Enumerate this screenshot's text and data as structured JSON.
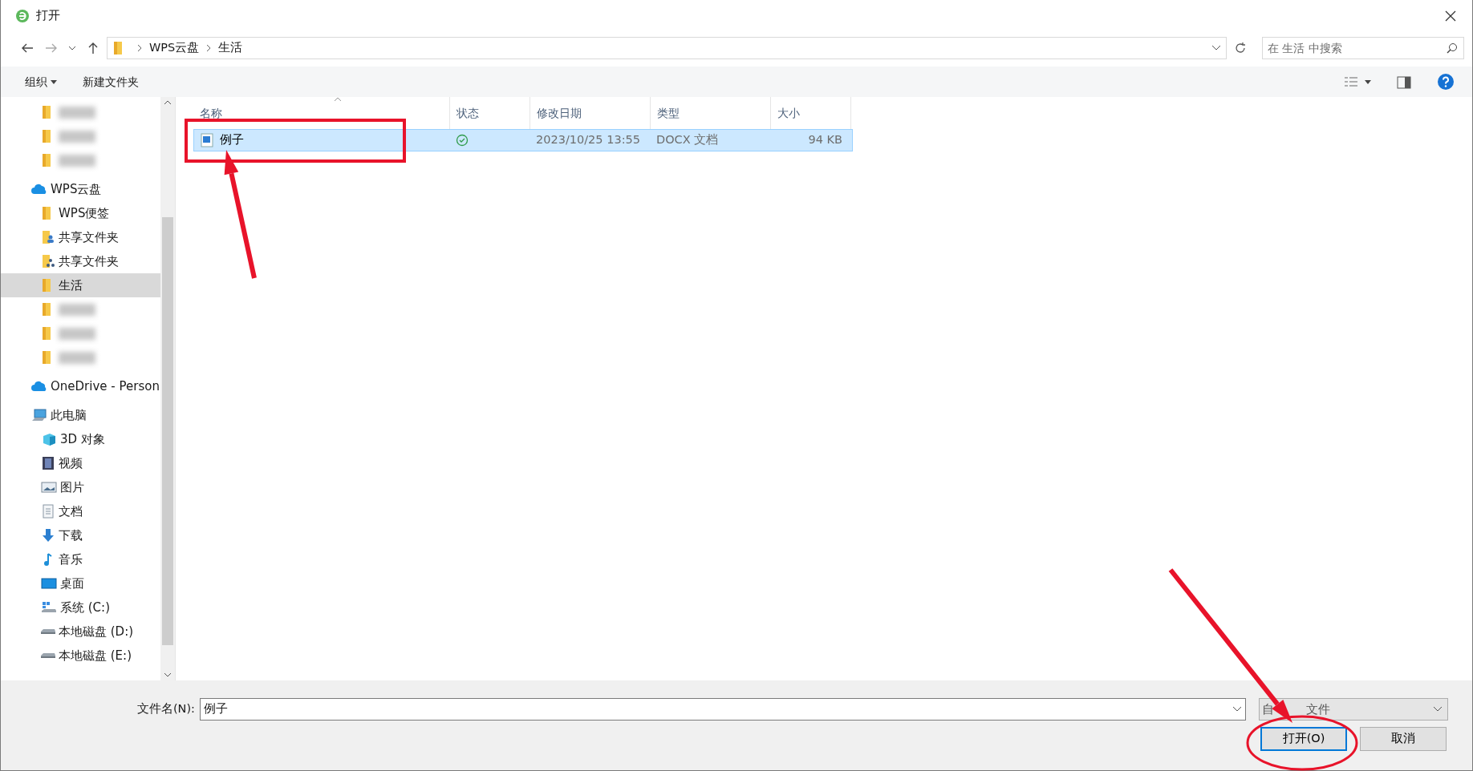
{
  "window": {
    "title": "打开"
  },
  "address": {
    "path": [
      "WPS云盘",
      "生活"
    ]
  },
  "search": {
    "placeholder": "在 生活 中搜索"
  },
  "toolbar": {
    "organize": "组织",
    "new_folder": "新建文件夹"
  },
  "sidebar": {
    "items": [
      {
        "kind": "folder",
        "blurred": true,
        "selected": false
      },
      {
        "kind": "folder",
        "blurred": true,
        "selected": false
      },
      {
        "kind": "folder",
        "blurred": true,
        "selected": false
      },
      {
        "kind": "cloud",
        "label": "WPS云盘",
        "selected": false,
        "children": [
          {
            "kind": "folder",
            "label": "WPS便签",
            "selected": false
          },
          {
            "kind": "shared",
            "label": "共享文件夹",
            "selected": false
          },
          {
            "kind": "shared2",
            "label": "共享文件夹",
            "selected": false
          },
          {
            "kind": "folder",
            "label": "生活",
            "selected": true
          },
          {
            "kind": "folder",
            "blurred": true,
            "selected": false
          },
          {
            "kind": "folder",
            "blurred": true,
            "selected": false
          },
          {
            "kind": "folder",
            "blurred": true,
            "selected": false
          }
        ]
      },
      {
        "kind": "cloud",
        "label": "OneDrive - Person",
        "selected": false
      },
      {
        "kind": "pc",
        "label": "此电脑",
        "selected": false,
        "children": [
          {
            "kind": "cube",
            "label": "3D 对象",
            "selected": false
          },
          {
            "kind": "video",
            "label": "视频",
            "selected": false
          },
          {
            "kind": "image",
            "label": "图片",
            "selected": false
          },
          {
            "kind": "doc",
            "label": "文档",
            "selected": false
          },
          {
            "kind": "download",
            "label": "下载",
            "selected": false
          },
          {
            "kind": "music",
            "label": "音乐",
            "selected": false
          },
          {
            "kind": "desktop",
            "label": "桌面",
            "selected": false
          },
          {
            "kind": "sysdrive",
            "label": "系统 (C:)",
            "selected": false
          },
          {
            "kind": "drive",
            "label": "本地磁盘 (D:)",
            "selected": false
          },
          {
            "kind": "drive",
            "label": "本地磁盘 (E:)",
            "selected": false
          }
        ]
      }
    ]
  },
  "file_list": {
    "columns": [
      "名称",
      "状态",
      "修改日期",
      "类型",
      "大小"
    ],
    "rows": [
      {
        "name": "例子",
        "synced": true,
        "modified": "2023/10/25 13:55",
        "type": "DOCX 文档",
        "size": "94 KB",
        "selected": true
      }
    ]
  },
  "footer": {
    "filename_label": "文件名(N):",
    "filename": "例子",
    "filetype_parts": [
      "自",
      "文件"
    ],
    "buttons": [
      {
        "label": "打开(O)",
        "kind": "primary"
      },
      {
        "label": "取消",
        "kind": "secondary"
      }
    ]
  },
  "annotations": [
    {
      "kind": "box"
    },
    {
      "kind": "arrow"
    },
    {
      "kind": "arrow"
    },
    {
      "kind": "ellipse"
    }
  ]
}
